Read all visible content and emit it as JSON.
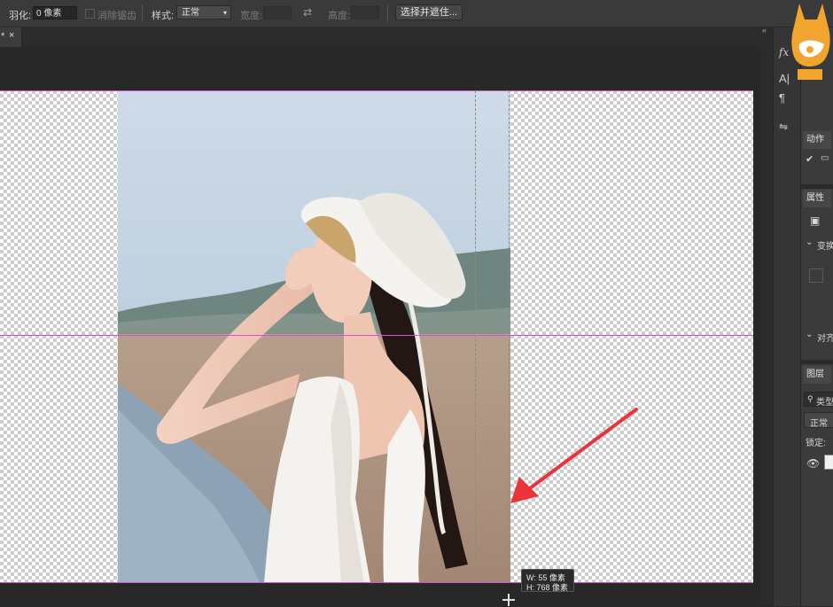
{
  "options_bar": {
    "feather_label": "羽化:",
    "feather_value": "0 像素",
    "antialias_label": "消除锯齿",
    "style_label": "样式:",
    "style_value": "正常",
    "width_label": "宽度:",
    "height_label": "高度:",
    "select_mask_button": "选择并遮住..."
  },
  "tab": {
    "modified_marker": "*",
    "close_glyph": "×"
  },
  "measure_tooltip": {
    "width": "W:  55 像素",
    "height": "H: 768 像素"
  },
  "right_panel": {
    "actions_tab": "动作",
    "properties_tab": "属性",
    "transform_section": "变换",
    "align_section": "对齐",
    "layers_tab": "图层",
    "kind_filter": "类型",
    "blend_mode": "正常",
    "lock_label": "锁定:"
  },
  "icons": {
    "fx": "fx-icon",
    "character": "character-icon",
    "paragraph": "paragraph-icon",
    "swap": "swap-icon"
  },
  "colors": {
    "guide": "#d64fd6",
    "annotation_arrow": "#e8343a",
    "logo": "#f2a52e"
  }
}
